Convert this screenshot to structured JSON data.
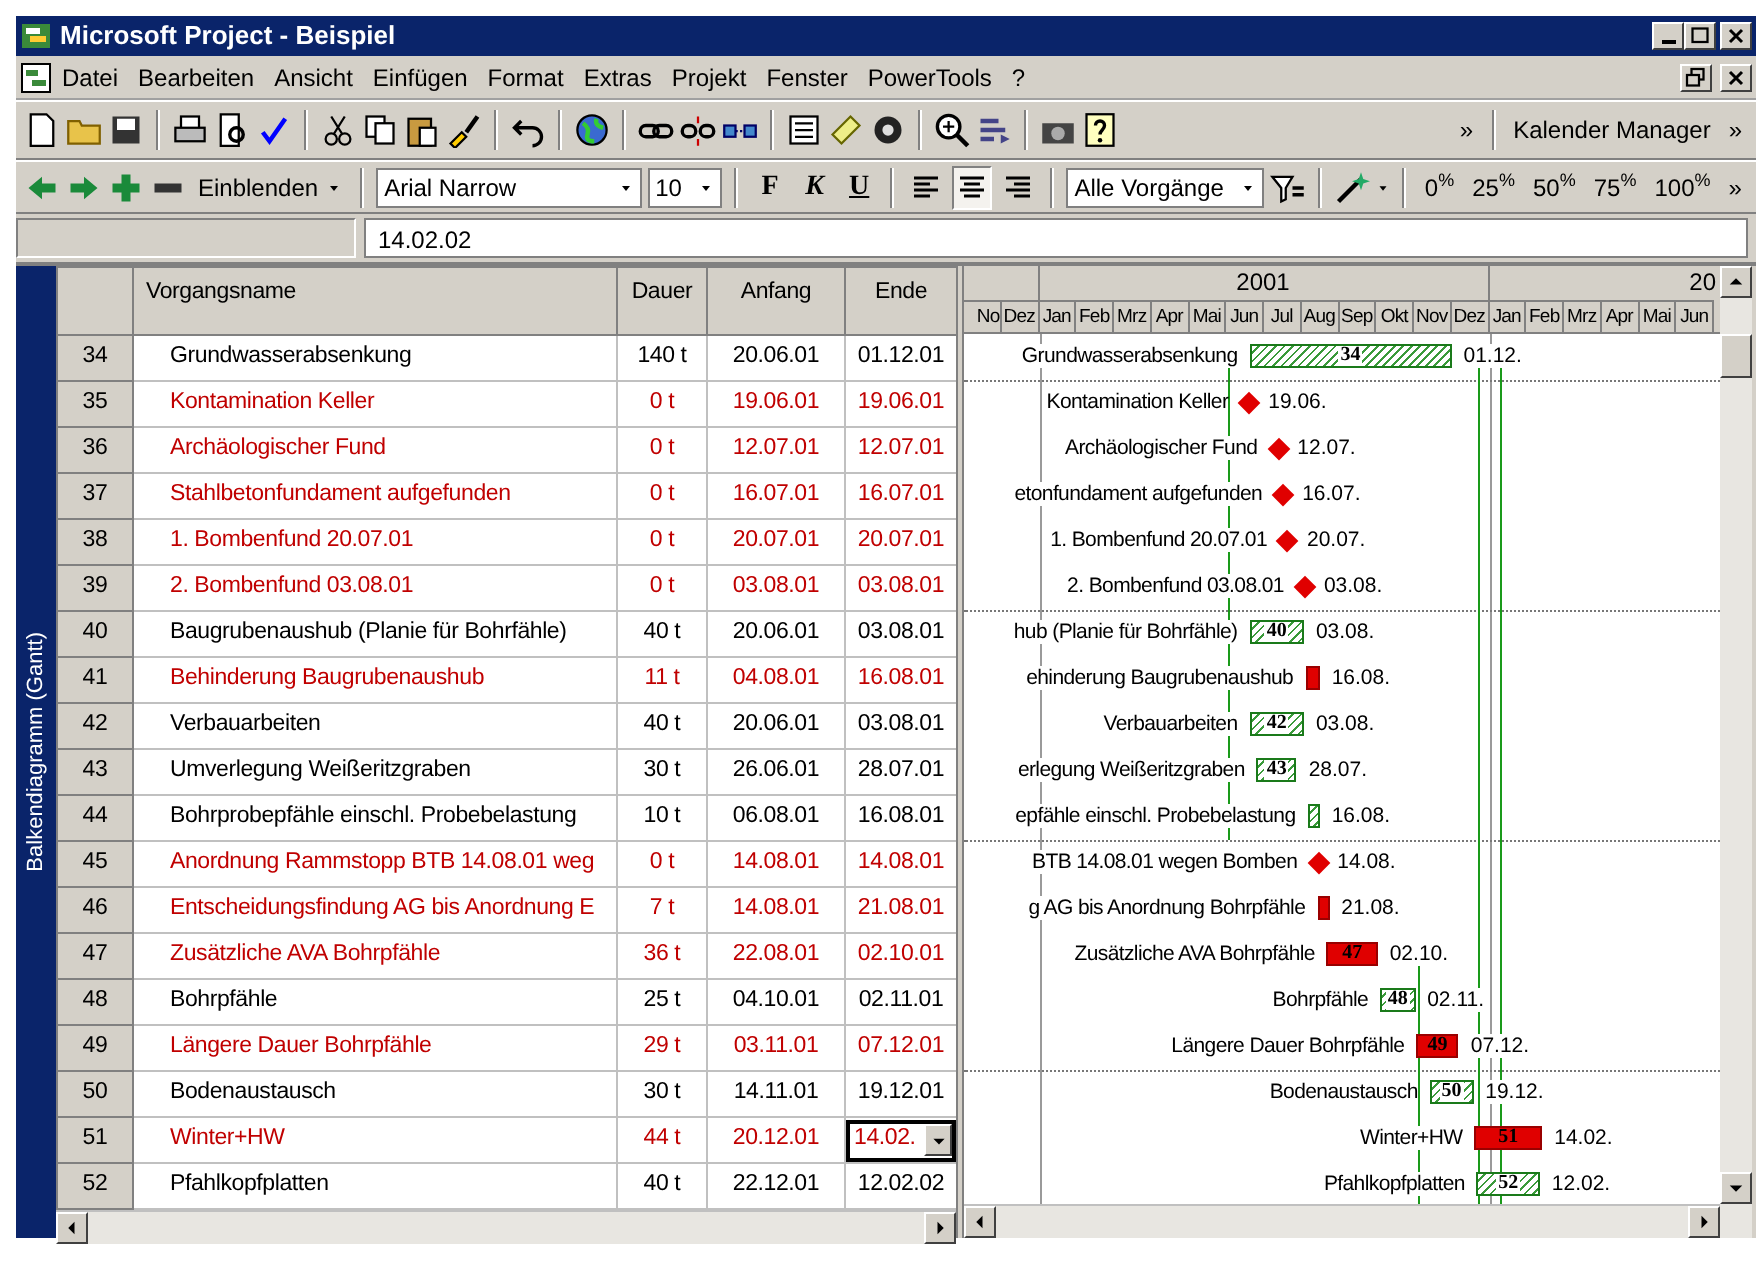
{
  "window": {
    "title": "Microsoft Project - Beispiel"
  },
  "menu": {
    "items": [
      "Datei",
      "Bearbeiten",
      "Ansicht",
      "Einfügen",
      "Format",
      "Extras",
      "Projekt",
      "Fenster",
      "PowerTools",
      "?"
    ]
  },
  "toolbar_standard": {
    "overflow": "»",
    "calendar_manager": "Kalender Manager",
    "overflow_end": "»"
  },
  "toolbar_format": {
    "show_menu": "Einblenden",
    "font": "Arial Narrow",
    "size": "10",
    "bold": "F",
    "italic": "K",
    "underline": "U",
    "align": [
      {
        "selected": false
      },
      {
        "selected": true
      },
      {
        "selected": false
      }
    ],
    "filter": "Alle Vorgänge",
    "percent": [
      "0$^{%}$",
      "25$^{%}$",
      "50$^{%}$",
      "75$^{%}$",
      "100$^{%}$"
    ],
    "overflow": "»"
  },
  "entry_bar": {
    "value": "14.02.02"
  },
  "view_bar": {
    "label": "Balkendiagramm (Gantt)"
  },
  "table": {
    "columns": [
      "Vorgangsname",
      "Dauer",
      "Anfang",
      "Ende"
    ],
    "rows": [
      {
        "id": "34",
        "name": "Grundwasserabsenkung",
        "duration": "140 t",
        "start": "20.06.01",
        "finish": "01.12.01",
        "critical": false,
        "selected": false
      },
      {
        "id": "35",
        "name": "Kontamination Keller",
        "duration": "0 t",
        "start": "19.06.01",
        "finish": "19.06.01",
        "critical": true,
        "selected": false
      },
      {
        "id": "36",
        "name": "Archäologischer Fund",
        "duration": "0 t",
        "start": "12.07.01",
        "finish": "12.07.01",
        "critical": true,
        "selected": false
      },
      {
        "id": "37",
        "name": "Stahlbetonfundament aufgefunden",
        "duration": "0 t",
        "start": "16.07.01",
        "finish": "16.07.01",
        "critical": true,
        "selected": false
      },
      {
        "id": "38",
        "name": "1. Bombenfund 20.07.01",
        "duration": "0 t",
        "start": "20.07.01",
        "finish": "20.07.01",
        "critical": true,
        "selected": false
      },
      {
        "id": "39",
        "name": "2. Bombenfund 03.08.01",
        "duration": "0 t",
        "start": "03.08.01",
        "finish": "03.08.01",
        "critical": true,
        "selected": false
      },
      {
        "id": "40",
        "name": "Baugrubenaushub (Planie für Bohrfähle)",
        "duration": "40 t",
        "start": "20.06.01",
        "finish": "03.08.01",
        "critical": false,
        "selected": false
      },
      {
        "id": "41",
        "name": "Behinderung Baugrubenaushub",
        "duration": "11 t",
        "start": "04.08.01",
        "finish": "16.08.01",
        "critical": true,
        "selected": false
      },
      {
        "id": "42",
        "name": "Verbauarbeiten",
        "duration": "40 t",
        "start": "20.06.01",
        "finish": "03.08.01",
        "critical": false,
        "selected": false
      },
      {
        "id": "43",
        "name": "Umverlegung Weißeritzgraben",
        "duration": "30 t",
        "start": "26.06.01",
        "finish": "28.07.01",
        "critical": false,
        "selected": false
      },
      {
        "id": "44",
        "name": "Bohrprobepfähle einschl. Probebelastung",
        "duration": "10 t",
        "start": "06.08.01",
        "finish": "16.08.01",
        "critical": false,
        "selected": false
      },
      {
        "id": "45",
        "name": "Anordnung Rammstopp BTB 14.08.01 weg",
        "duration": "0 t",
        "start": "14.08.01",
        "finish": "14.08.01",
        "critical": true,
        "selected": false
      },
      {
        "id": "46",
        "name": "Entscheidungsfindung AG bis Anordnung E",
        "duration": "7 t",
        "start": "14.08.01",
        "finish": "21.08.01",
        "critical": true,
        "selected": false
      },
      {
        "id": "47",
        "name": "Zusätzliche AVA Bohrpfähle",
        "duration": "36 t",
        "start": "22.08.01",
        "finish": "02.10.01",
        "critical": true,
        "selected": false
      },
      {
        "id": "48",
        "name": "Bohrpfähle",
        "duration": "25 t",
        "start": "04.10.01",
        "finish": "02.11.01",
        "critical": false,
        "selected": false
      },
      {
        "id": "49",
        "name": "Längere Dauer Bohrpfähle",
        "duration": "29 t",
        "start": "03.11.01",
        "finish": "07.12.01",
        "critical": true,
        "selected": false
      },
      {
        "id": "50",
        "name": "Bodenaustausch",
        "duration": "30 t",
        "start": "14.11.01",
        "finish": "19.12.01",
        "critical": false,
        "selected": false
      },
      {
        "id": "51",
        "name": "Winter+HW",
        "duration": "44 t",
        "start": "20.12.01",
        "finish": "14.02.",
        "critical": true,
        "selected": true
      },
      {
        "id": "52",
        "name": "Pfahlkopfplatten",
        "duration": "40 t",
        "start": "22.12.01",
        "finish": "12.02.02",
        "critical": false,
        "selected": false
      }
    ]
  },
  "gantt": {
    "years": [
      "2001",
      "20"
    ],
    "months": [
      "No",
      "Dez",
      "Jan",
      "Feb",
      "Mrz",
      "Apr",
      "Mai",
      "Jun",
      "Jul",
      "Aug",
      "Sep",
      "Okt",
      "Nov",
      "Dez",
      "Jan",
      "Feb",
      "Mrz",
      "Apr",
      "Mai",
      "Jun"
    ],
    "tasks": [
      {
        "kind": "task",
        "critical": false,
        "label": "Grundwasserabsenkung",
        "bar_label": "34",
        "date": "01.12."
      },
      {
        "kind": "milestone",
        "critical": true,
        "label": "Kontamination Keller",
        "date": "19.06."
      },
      {
        "kind": "milestone",
        "critical": true,
        "label": "Archäologischer Fund",
        "date": "12.07."
      },
      {
        "kind": "milestone",
        "critical": true,
        "label": "etonfundament aufgefunden",
        "date": "16.07."
      },
      {
        "kind": "milestone",
        "critical": true,
        "label": "1. Bombenfund 20.07.01",
        "date": "20.07."
      },
      {
        "kind": "milestone",
        "critical": true,
        "label": "2. Bombenfund 03.08.01",
        "date": "03.08."
      },
      {
        "kind": "task",
        "critical": false,
        "label": "hub (Planie für Bohrfähle)",
        "bar_label": "40",
        "date": "03.08."
      },
      {
        "kind": "task",
        "critical": true,
        "label": "ehinderung Baugrubenaushub",
        "date": "16.08."
      },
      {
        "kind": "task",
        "critical": false,
        "label": "Verbauarbeiten",
        "bar_label": "42",
        "date": "03.08."
      },
      {
        "kind": "task",
        "critical": false,
        "label": "erlegung Weißeritzgraben",
        "bar_label": "43",
        "date": "28.07."
      },
      {
        "kind": "task",
        "critical": false,
        "label": "epfähle einschl. Probebelastung",
        "date": "16.08."
      },
      {
        "kind": "milestone",
        "critical": true,
        "label": "BTB 14.08.01 wegen Bomben",
        "date": "14.08."
      },
      {
        "kind": "task",
        "critical": true,
        "label": "g AG bis Anordnung Bohrpfähle",
        "date": "21.08."
      },
      {
        "kind": "task",
        "critical": true,
        "label": "Zusätzliche AVA Bohrpfähle",
        "bar_label": "47",
        "date": "02.10."
      },
      {
        "kind": "task",
        "critical": false,
        "label": "Bohrpfähle",
        "bar_label": "48",
        "date": "02.11."
      },
      {
        "kind": "task",
        "critical": true,
        "label": "Längere Dauer Bohrpfähle",
        "bar_label": "49",
        "date": "07.12."
      },
      {
        "kind": "task",
        "critical": false,
        "label": "Bodenaustausch",
        "bar_label": "50",
        "date": "19.12."
      },
      {
        "kind": "task",
        "critical": true,
        "label": "Winter+HW",
        "bar_label": "51",
        "date": "14.02."
      },
      {
        "kind": "task",
        "critical": false,
        "label": "Pfahlkopfplatten",
        "bar_label": "52",
        "date": "12.02."
      }
    ]
  }
}
